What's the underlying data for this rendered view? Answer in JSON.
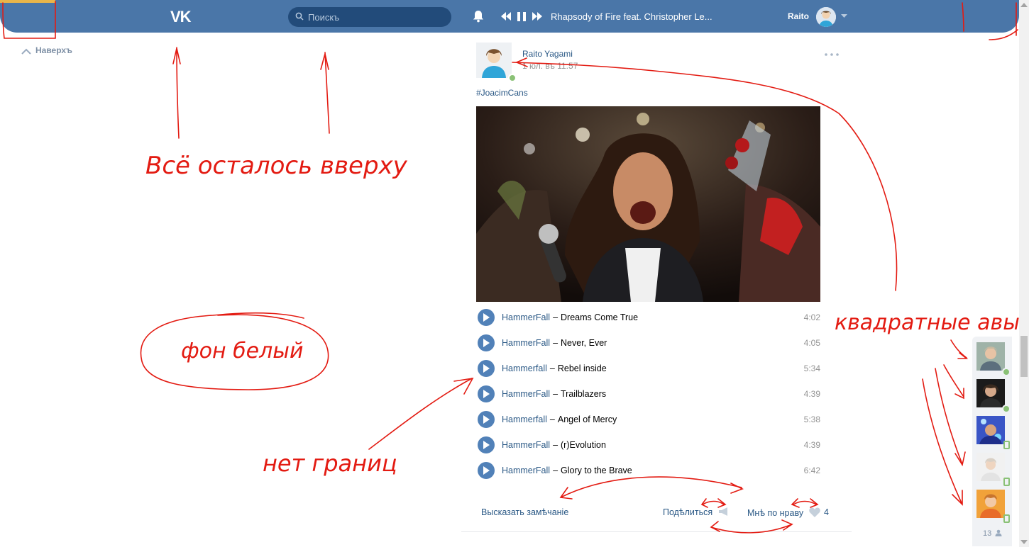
{
  "header": {
    "logo_text": "VK",
    "search_placeholder": "Поискъ",
    "player": {
      "track": "Rhapsody of Fire feat. Christopher Le..."
    },
    "user_name": "Raito"
  },
  "scroll_up_label": "Наверхъ",
  "post": {
    "author": "Raito Yagami",
    "date": "1 юл. въ 11:57",
    "hashtag": "#JoacimCans",
    "tracks": [
      {
        "artist": "HammerFall",
        "title": "Dreams Come True",
        "duration": "4:02"
      },
      {
        "artist": "HammerFall",
        "title": "Never, Ever",
        "duration": "4:05"
      },
      {
        "artist": "Hammerfall",
        "title": "Rebel inside",
        "duration": "5:34"
      },
      {
        "artist": "HammerFall",
        "title": "Trailblazers",
        "duration": "4:39"
      },
      {
        "artist": "Hammerfall",
        "title": "Angel of Mercy",
        "duration": "5:38"
      },
      {
        "artist": "HammerFall",
        "title": "(r)Evolution",
        "duration": "4:39"
      },
      {
        "artist": "HammerFall",
        "title": "Glory to the Brave",
        "duration": "6:42"
      }
    ],
    "comment_label": "Высказать замѣчаніе",
    "share_label": "Подѣлиться",
    "like_label": "Мнѣ по нраву",
    "like_count": "4"
  },
  "friends_count": "13",
  "annotations": {
    "top_note": "Всё осталось вверху",
    "bg_note": "фон белый",
    "border_note": "нет границ",
    "avatars_note": "квадратные авы"
  },
  "colors": {
    "header": "#4a76a8",
    "link": "#2a5885",
    "accent": "#5181b8",
    "annotation": "#e31b12"
  }
}
